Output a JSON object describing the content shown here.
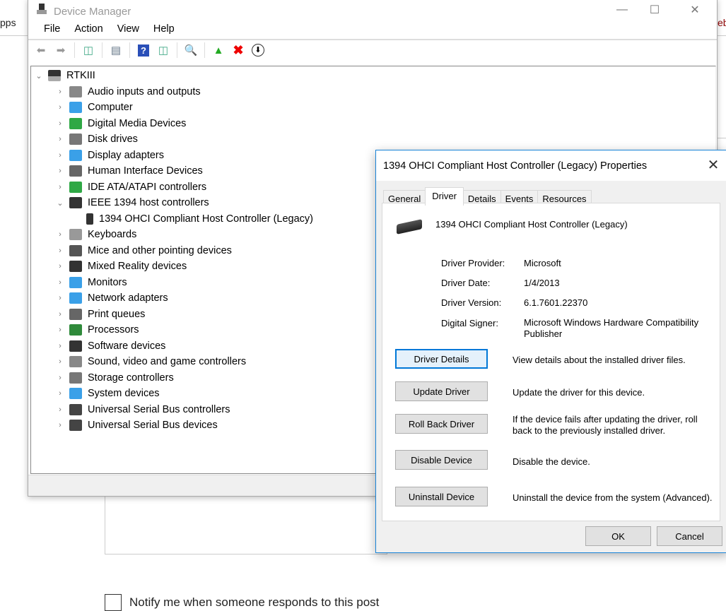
{
  "background": {
    "left_text": "pps",
    "right_text": "eb",
    "notify_label": "Notify me when someone responds to this post"
  },
  "device_manager": {
    "title": "Device Manager",
    "menu": [
      "File",
      "Action",
      "View",
      "Help"
    ],
    "toolbar": [
      "back-icon",
      "forward-icon",
      "show-hide-console-tree-icon",
      "properties-icon",
      "help-icon",
      "action-pane-icon",
      "scan-hardware-icon",
      "update-driver-icon",
      "uninstall-icon",
      "disable-icon"
    ],
    "root": "RTKIII",
    "categories": [
      {
        "label": "Audio inputs and outputs",
        "icon": "speaker-icon",
        "color": "#888888"
      },
      {
        "label": "Computer",
        "icon": "monitor-icon",
        "color": "#3aa0e8"
      },
      {
        "label": "Digital Media Devices",
        "icon": "media-device-icon",
        "color": "#2fa845"
      },
      {
        "label": "Disk drives",
        "icon": "disk-icon",
        "color": "#777777"
      },
      {
        "label": "Display adapters",
        "icon": "display-adapter-icon",
        "color": "#3aa0e8"
      },
      {
        "label": "Human Interface Devices",
        "icon": "hid-icon",
        "color": "#666666"
      },
      {
        "label": "IDE ATA/ATAPI controllers",
        "icon": "ide-icon",
        "color": "#2fa845"
      },
      {
        "label": "IEEE 1394 host controllers",
        "icon": "firewire-icon",
        "color": "#333333",
        "expanded": true,
        "children": [
          "1394 OHCI Compliant Host Controller (Legacy)"
        ]
      },
      {
        "label": "Keyboards",
        "icon": "keyboard-icon",
        "color": "#999999"
      },
      {
        "label": "Mice and other pointing devices",
        "icon": "mouse-icon",
        "color": "#555555"
      },
      {
        "label": "Mixed Reality devices",
        "icon": "headset-icon",
        "color": "#333333"
      },
      {
        "label": "Monitors",
        "icon": "monitor-icon",
        "color": "#3aa0e8"
      },
      {
        "label": "Network adapters",
        "icon": "network-icon",
        "color": "#3aa0e8"
      },
      {
        "label": "Print queues",
        "icon": "printer-icon",
        "color": "#666666"
      },
      {
        "label": "Processors",
        "icon": "processor-icon",
        "color": "#2f8a3a"
      },
      {
        "label": "Software devices",
        "icon": "software-device-icon",
        "color": "#333333"
      },
      {
        "label": "Sound, video and game controllers",
        "icon": "speaker-icon",
        "color": "#888888"
      },
      {
        "label": "Storage controllers",
        "icon": "storage-icon",
        "color": "#777777"
      },
      {
        "label": "System devices",
        "icon": "system-icon",
        "color": "#3aa0e8"
      },
      {
        "label": "Universal Serial Bus controllers",
        "icon": "usb-icon",
        "color": "#444444"
      },
      {
        "label": "Universal Serial Bus devices",
        "icon": "usb-icon",
        "color": "#444444"
      }
    ]
  },
  "dialog": {
    "title": "1394 OHCI Compliant Host Controller (Legacy) Properties",
    "tabs": [
      "General",
      "Driver",
      "Details",
      "Events",
      "Resources"
    ],
    "active_tab": "Driver",
    "device_name": "1394 OHCI Compliant Host Controller (Legacy)",
    "fields": [
      {
        "label": "Driver Provider:",
        "value": "Microsoft"
      },
      {
        "label": "Driver Date:",
        "value": "1/4/2013"
      },
      {
        "label": "Driver Version:",
        "value": "6.1.7601.22370"
      },
      {
        "label": "Digital Signer:",
        "value": "Microsoft Windows Hardware Compatibility Publisher"
      }
    ],
    "actions": [
      {
        "button": "Driver Details",
        "desc": "View details about the installed driver files."
      },
      {
        "button": "Update Driver",
        "desc": "Update the driver for this device."
      },
      {
        "button": "Roll Back Driver",
        "desc": "If the device fails after updating the driver, roll back to the previously installed driver."
      },
      {
        "button": "Disable Device",
        "desc": "Disable the device."
      },
      {
        "button": "Uninstall Device",
        "desc": "Uninstall the device from the system (Advanced)."
      }
    ],
    "ok": "OK",
    "cancel": "Cancel",
    "accent": "#1883d7"
  }
}
